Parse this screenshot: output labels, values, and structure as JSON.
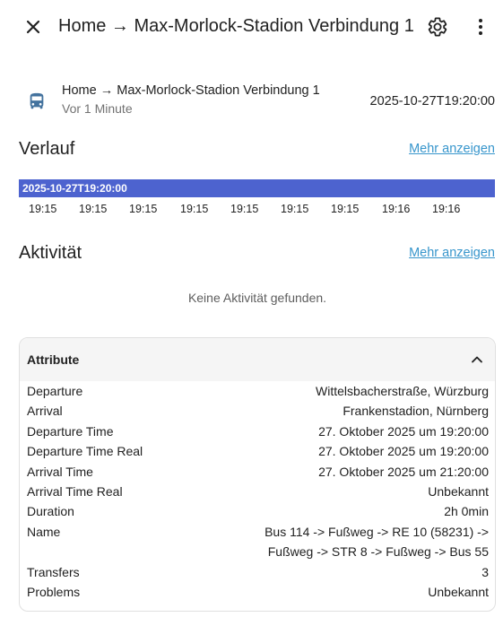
{
  "header": {
    "title": "Home → Max-Morlock-Stadion Verbindung 1",
    "close_icon": "close-icon",
    "settings_icon": "gear-icon",
    "more_icon": "more-vert-icon"
  },
  "entity": {
    "icon": "bus-icon",
    "name": "Home → Max-Morlock-Stadion Verbindung 1",
    "last_changed": "Vor 1 Minute",
    "state": "2025-10-27T19:20:00"
  },
  "history": {
    "title": "Verlauf",
    "more_label": "Mehr anzeigen",
    "bar_label": "2025-10-27T19:20:00",
    "bar_color": "#4d63cf",
    "ticks": [
      "19:15",
      "19:15",
      "19:15",
      "19:15",
      "19:15",
      "19:15",
      "19:15",
      "19:16",
      "19:16"
    ]
  },
  "activity": {
    "title": "Aktivität",
    "more_label": "Mehr anzeigen",
    "empty_text": "Keine Aktivität gefunden."
  },
  "attributes": {
    "title": "Attribute",
    "rows": [
      {
        "key": "Departure",
        "value": "Wittelsbacherstraße, Würzburg"
      },
      {
        "key": "Arrival",
        "value": "Frankenstadion, Nürnberg"
      },
      {
        "key": "Departure Time",
        "value": "27. Oktober 2025 um 19:20:00"
      },
      {
        "key": "Departure Time Real",
        "value": "27. Oktober 2025 um 19:20:00"
      },
      {
        "key": "Arrival Time",
        "value": "27. Oktober 2025 um 21:20:00"
      },
      {
        "key": "Arrival Time Real",
        "value": "Unbekannt"
      },
      {
        "key": "Duration",
        "value": "2h 0min"
      },
      {
        "key": "Name",
        "value_line1": "Bus 114 -> Fußweg -> RE 10 (58231) ->",
        "value_line2": "Fußweg -> STR 8 -> Fußweg -> Bus 55"
      },
      {
        "key": "Transfers",
        "value": "3"
      },
      {
        "key": "Problems",
        "value": "Unbekannt"
      }
    ]
  },
  "colors": {
    "accent_link": "#3896cc",
    "timeline_bar": "#4d63cf",
    "entity_icon": "#44739e"
  }
}
